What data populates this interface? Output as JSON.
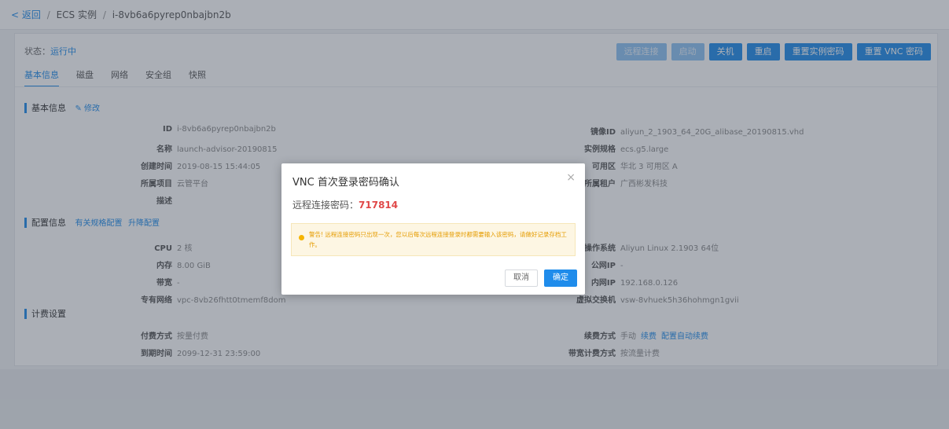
{
  "breadcrumb": {
    "back": "< 返回",
    "sep": "/",
    "instances": "ECS 实例",
    "sep2": "/",
    "instance_id": "i-8vb6a6pyrep0nbajbn2b"
  },
  "status": {
    "label": "状态：",
    "value": "运行中"
  },
  "actions": [
    {
      "label": "远程连接",
      "state": "disabled"
    },
    {
      "label": "启动",
      "state": "disabled"
    },
    {
      "label": "关机",
      "state": "normal"
    },
    {
      "label": "重启",
      "state": "normal"
    },
    {
      "label": "重置实例密码",
      "state": "normal"
    },
    {
      "label": "重置 VNC 密码",
      "state": "normal"
    }
  ],
  "tabs": [
    {
      "label": "基本信息",
      "active": true
    },
    {
      "label": "磁盘",
      "active": false
    },
    {
      "label": "网络",
      "active": false
    },
    {
      "label": "安全组",
      "active": false
    },
    {
      "label": "快照",
      "active": false
    }
  ],
  "basic": {
    "title": "基本信息",
    "edit_link": "✎ 修改",
    "left": [
      {
        "k": "ID",
        "v": "i-8vb6a6pyrep0nbajbn2b"
      },
      {
        "k": "名称",
        "v": "launch-advisor-20190815"
      },
      {
        "k": "创建时间",
        "v": "2019-08-15 15:44:05"
      },
      {
        "k": "所属项目",
        "v": "云管平台"
      },
      {
        "k": "描述",
        "v": ""
      }
    ],
    "right": [
      {
        "k": "镜像ID",
        "v": "aliyun_2_1903_64_20G_alibase_20190815.vhd"
      },
      {
        "k": "实例规格",
        "v": "ecs.g5.large"
      },
      {
        "k": "可用区",
        "v": "华北 3 可用区 A"
      },
      {
        "k": "所属租户",
        "v": "广西彬发科技"
      }
    ]
  },
  "config": {
    "title": "配置信息",
    "link1": "有关规格配置",
    "link2": "升降配置",
    "left": [
      {
        "k": "CPU",
        "v": "2 核"
      },
      {
        "k": "内存",
        "v": "8.00 GiB"
      },
      {
        "k": "带宽",
        "v": "-"
      },
      {
        "k": "专有网络",
        "v": "vpc-8vb26fhtt0tmemf8dom"
      }
    ],
    "right": [
      {
        "k": "操作系统",
        "v": "Aliyun Linux 2.1903 64位"
      },
      {
        "k": "公网IP",
        "v": "-"
      },
      {
        "k": "内网IP",
        "v": "192.168.0.126"
      },
      {
        "k": "虚拟交换机",
        "v": "vsw-8vhuek5h36hohmgn1gvii"
      }
    ]
  },
  "billing": {
    "title": "计费设置",
    "left": [
      {
        "k": "付费方式",
        "v": "按量付费"
      },
      {
        "k": "到期时间",
        "v": "2099-12-31 23:59:00"
      }
    ],
    "right": [
      {
        "k": "续费方式",
        "v": "手动",
        "link1": "续费",
        "link2": "配置自动续费"
      },
      {
        "k": "带宽计费方式",
        "v": "按流量计费"
      }
    ]
  },
  "modal": {
    "title": "VNC 首次登录密码确认",
    "close": "×",
    "pw_label": "远程连接密码：",
    "pw_value": "717814",
    "warning": "警告! 远程连接密码只出现一次，您以后每次远程连接登录时都需要输入该密码，请做好记录存档工作。",
    "cancel": "取消",
    "ok": "确定"
  }
}
